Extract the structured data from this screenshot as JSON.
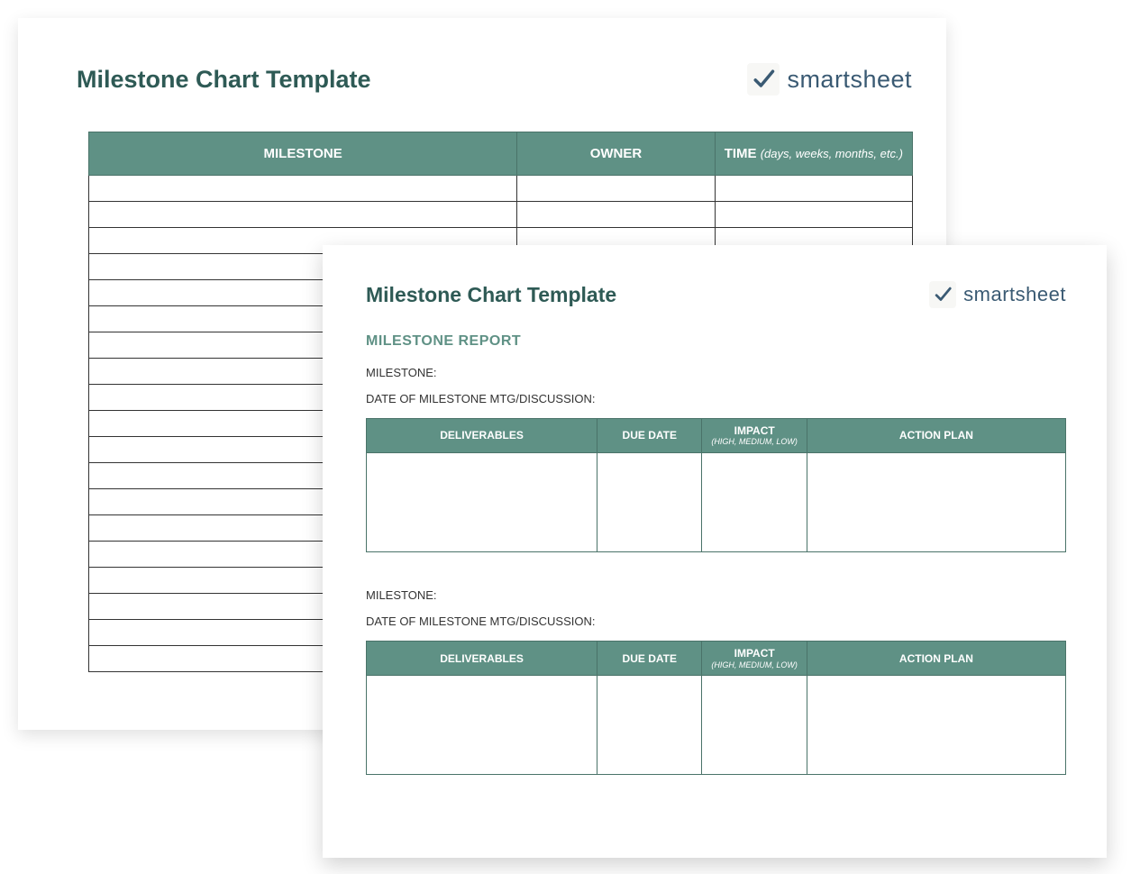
{
  "page1": {
    "title": "Milestone Chart Template",
    "brand": "smartsheet",
    "table": {
      "col_milestone": "MILESTONE",
      "col_owner": "OWNER",
      "col_time": "TIME",
      "col_time_sub": "(days, weeks, months, etc.)"
    }
  },
  "page2": {
    "title": "Milestone Chart Template",
    "brand": "smartsheet",
    "section_title": "MILESTONE REPORT",
    "label_milestone": "MILESTONE:",
    "label_date": "DATE OF MILESTONE MTG/DISCUSSION:",
    "table": {
      "col_deliverables": "DELIVERABLES",
      "col_due": "DUE DATE",
      "col_impact": "IMPACT",
      "col_impact_sub": "(HIGH, MEDIUM, LOW)",
      "col_action": "ACTION PLAN"
    }
  }
}
